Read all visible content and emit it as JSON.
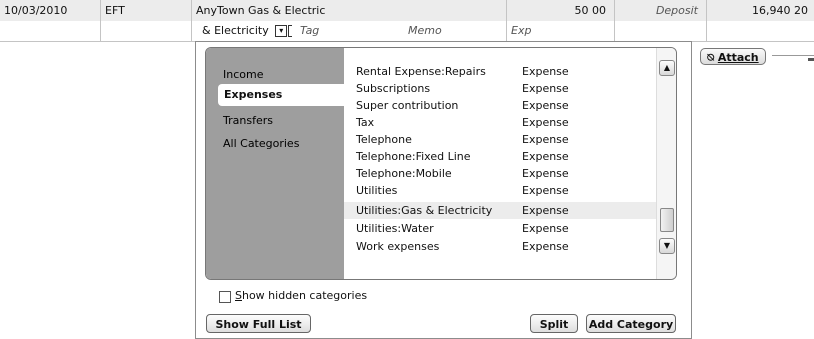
{
  "register": {
    "row1": {
      "date": "10/03/2010",
      "type": "EFT",
      "payee": "AnyTown Gas & Electric",
      "amount": "50 00",
      "deposit_placeholder": "Deposit",
      "balance": "16,940 20"
    },
    "row2": {
      "category_text": "& Electricity",
      "tag_placeholder": "Tag",
      "memo_placeholder": "Memo",
      "exp_placeholder": "Exp"
    },
    "attach_label": "Attach"
  },
  "popup": {
    "sidebar": [
      {
        "label": "Income"
      },
      {
        "label": "Expenses",
        "selected": true
      },
      {
        "label": "Transfers"
      },
      {
        "label": "All Categories"
      }
    ],
    "categories": [
      {
        "name": "Rental Expense:Repairs",
        "type": "Expense"
      },
      {
        "name": "Subscriptions",
        "type": "Expense"
      },
      {
        "name": "Super contribution",
        "type": "Expense"
      },
      {
        "name": "Tax",
        "type": "Expense"
      },
      {
        "name": "Telephone",
        "type": "Expense"
      },
      {
        "name": "Telephone:Fixed Line",
        "type": "Expense"
      },
      {
        "name": "Telephone:Mobile",
        "type": "Expense"
      },
      {
        "name": "Utilities",
        "type": "Expense"
      },
      {
        "name": "Utilities:Gas & Electricity",
        "type": "Expense",
        "selected": true
      },
      {
        "name": "Utilities:Water",
        "type": "Expense"
      },
      {
        "name": "Work expenses",
        "type": "Expense"
      }
    ],
    "show_hidden_label_first": "S",
    "show_hidden_label_rest": "how hidden categories",
    "show_hidden_checked": false,
    "buttons": {
      "show_full_list": "Show Full List",
      "split": "Split",
      "add_category": "Add Category"
    }
  },
  "icons": {
    "scroll_up": "scroll-up-arrow-icon",
    "scroll_down": "scroll-down-arrow-icon",
    "paperclip": "paperclip-icon"
  }
}
